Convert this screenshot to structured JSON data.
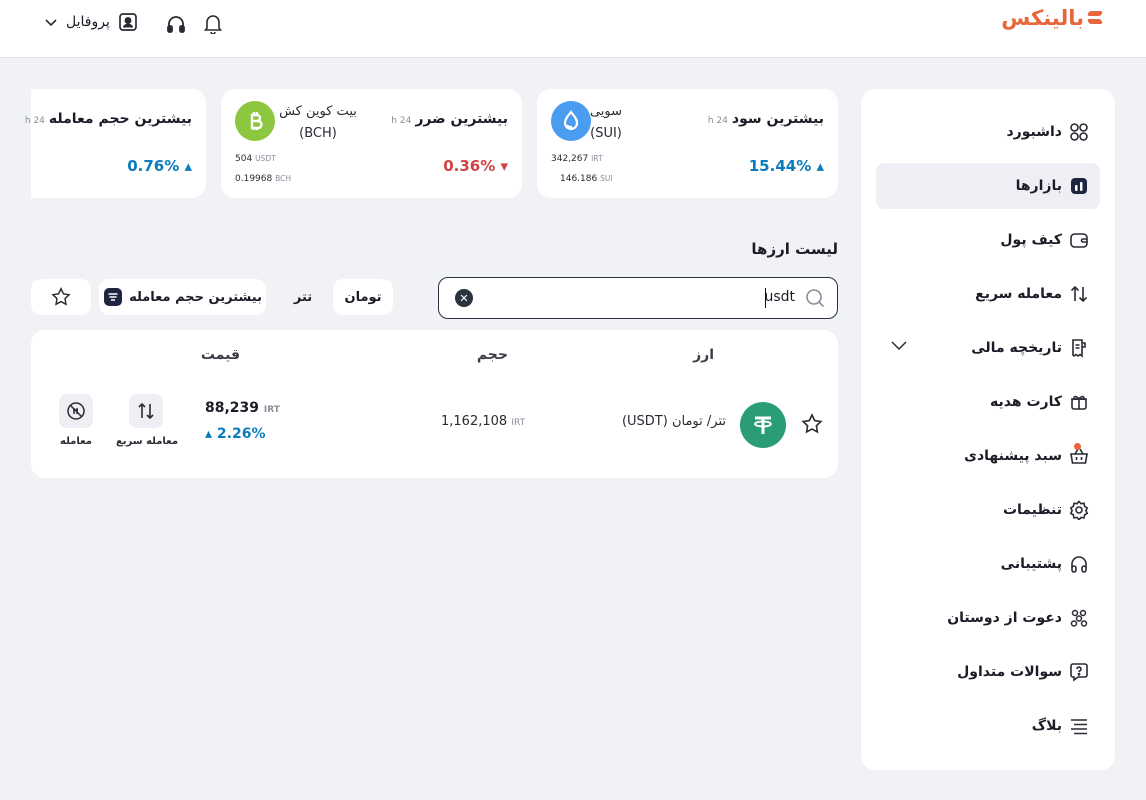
{
  "header": {
    "logo_text": "بالینکس",
    "profile_label": "پروفایل"
  },
  "sidebar": {
    "items": [
      {
        "label": "داشبورد",
        "icon": "dashboard-icon"
      },
      {
        "label": "بازارها",
        "icon": "markets-icon"
      },
      {
        "label": "کیف پول",
        "icon": "wallet-icon"
      },
      {
        "label": "معامله سریع",
        "icon": "swap-icon"
      },
      {
        "label": "تاریخچه مالی",
        "icon": "history-icon"
      },
      {
        "label": "کارت هدیه",
        "icon": "gift-icon"
      },
      {
        "label": "سبد پیشنهادی",
        "icon": "basket-icon"
      },
      {
        "label": "تنظیمات",
        "icon": "gear-icon"
      },
      {
        "label": "پشتیبانی",
        "icon": "headset-icon"
      },
      {
        "label": "دعوت از دوستان",
        "icon": "invite-icon"
      },
      {
        "label": "سوالات متداول",
        "icon": "faq-icon"
      },
      {
        "label": "بلاگ",
        "icon": "blog-icon"
      }
    ]
  },
  "stats": [
    {
      "title": "بیشترین سود",
      "period": "24 h",
      "coin_name": "سویی",
      "coin_symbol": "(SUI)",
      "change": "15.44%",
      "line1_value": "342,267",
      "line1_unit": "IRT",
      "line2_value": "146.186",
      "line2_unit": "SUI"
    },
    {
      "title": "بیشترین ضرر",
      "period": "24 h",
      "coin_name": "بیت کوین کش",
      "coin_symbol": "(BCH)",
      "change": "0.36%",
      "line1_value": "504",
      "line1_unit": "USDT",
      "line2_value": "0.19968",
      "line2_unit": "BCH"
    },
    {
      "title": "بیشترین حجم معامله",
      "period": "24 h",
      "change": "0.76%"
    }
  ],
  "colors": {
    "up": "#0a7cbd",
    "down": "#d14343",
    "accent": "#e8663b",
    "sui": "#4a9cf0",
    "bch": "#8dc63f",
    "usdt": "#2a9d78"
  },
  "list": {
    "title": "لیست ارزها",
    "search_value": "usdt",
    "filters": {
      "toman": "تومان",
      "tether": "تتر",
      "sort": "بیشترین حجم معامله"
    },
    "columns": {
      "coin": "ارز",
      "volume": "حجم",
      "price": "قیمت"
    },
    "row": {
      "pair": "تتر/ تومان (USDT)",
      "volume_value": "1,162,108",
      "volume_unit": "IRT",
      "price_value": "88,239",
      "price_unit": "IRT",
      "change": "2.26%",
      "quick_trade_label": "معامله سریع",
      "trade_label": "معامله"
    }
  }
}
